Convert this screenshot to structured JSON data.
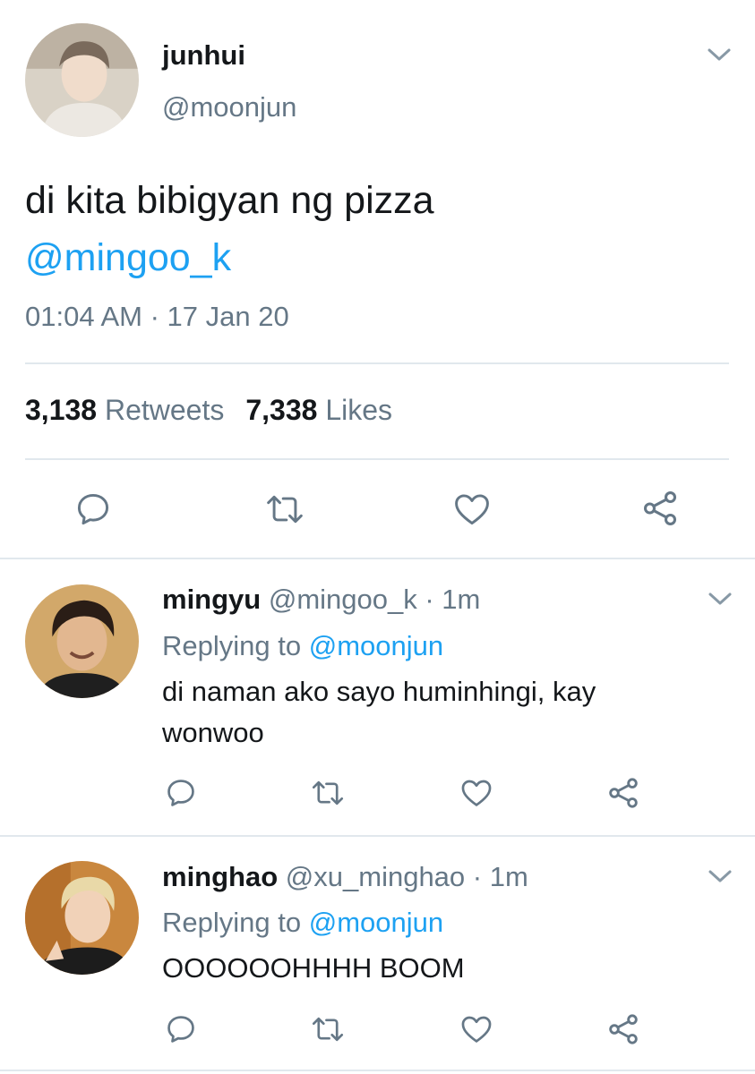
{
  "main_tweet": {
    "author_name": "junhui",
    "author_handle": "@moonjun",
    "text": "di kita bibigyan ng pizza",
    "mention": "@mingoo_k",
    "timestamp": "01:04 AM · 17 Jan 20",
    "retweets_count": "3,138",
    "retweets_label": "Retweets",
    "likes_count": "7,338",
    "likes_label": "Likes",
    "actions": [
      "reply-icon",
      "retweet-icon",
      "like-icon",
      "share-icon"
    ]
  },
  "replies": [
    {
      "name": "mingyu",
      "meta": "@mingoo_k · 1m",
      "replying_label": "Replying to",
      "replying_to": "@moonjun",
      "text": "di naman ako sayo huminhingi, kay wonwoo"
    },
    {
      "name": "minghao",
      "meta": "@xu_minghao · 1m",
      "replying_label": "Replying to",
      "replying_to": "@moonjun",
      "text": "OOOOOOHHHH BOOM"
    }
  ],
  "colors": {
    "accent": "#1da1f2",
    "text": "#14171a",
    "secondary": "#657786",
    "divider": "#e1e8ed"
  }
}
